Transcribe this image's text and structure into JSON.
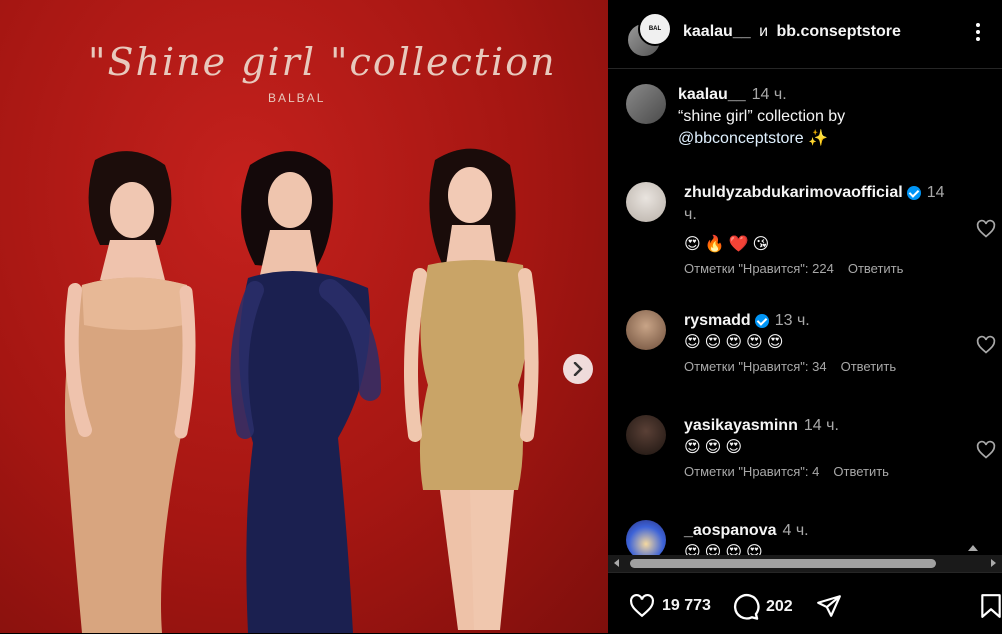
{
  "post": {
    "image": {
      "script_title": "\"Shine girl \"collection",
      "brand": "BALBAL"
    },
    "header": {
      "author": "kaalau__",
      "conjunction": "и",
      "collaborator": "bb.conseptstore",
      "collab_avatar_text": "BAL"
    }
  },
  "caption": {
    "username": "kaalau__",
    "time": "14 ч.",
    "text_before": "“shine girl” collection by",
    "mention": "@bbconceptstore",
    "text_after": " ✨"
  },
  "comments": [
    {
      "username": "zhuldyzabdukarimovaofficial",
      "verified": true,
      "time": "14 ч.",
      "text": "😍🔥❤️😘",
      "likes": "Отметки \"Нравится\": 224",
      "reply": "Ответить"
    },
    {
      "username": "rysmadd",
      "verified": true,
      "time": "13 ч.",
      "text": "😍😍😍😍😍",
      "likes": "Отметки \"Нравится\": 34",
      "reply": "Ответить"
    },
    {
      "username": "yasikayasminn",
      "verified": false,
      "time": "14 ч.",
      "text": "😍😍😍",
      "likes": "Отметки \"Нравится\": 4",
      "reply": "Ответить"
    },
    {
      "username": "_aospanova",
      "verified": false,
      "time": "4 ч.",
      "text": "😍😍😍😍",
      "likes": "",
      "reply": ""
    }
  ],
  "actions": {
    "likes_count": "19 773",
    "comments_count": "202"
  },
  "colors": {
    "background": "#000000",
    "photo_red": "#b31a15",
    "link": "#e0f1ff",
    "verified": "#0095f6"
  }
}
